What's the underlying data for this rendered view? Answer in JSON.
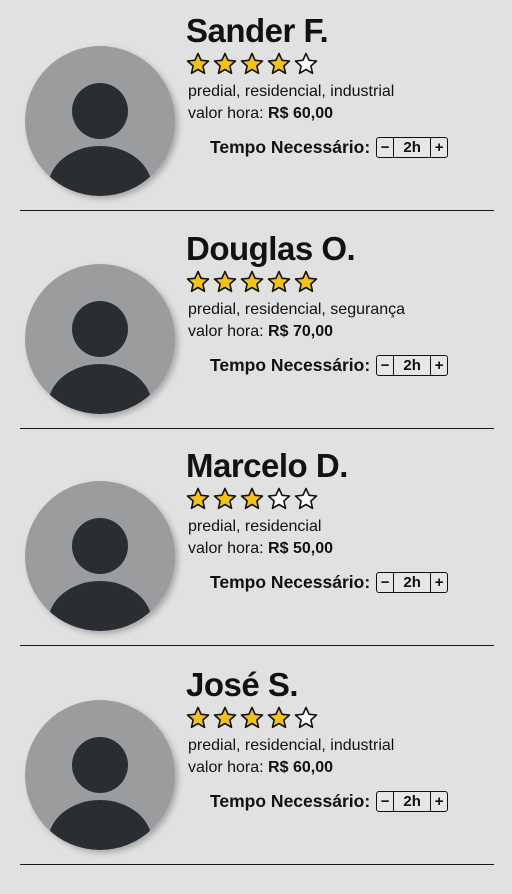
{
  "labels": {
    "rate_prefix": "valor hora:",
    "time_label": "Tempo Necessário:",
    "minus": "−",
    "plus": "+"
  },
  "colors": {
    "star_filled": "#f2c21b",
    "star_empty": "#ffffff",
    "avatar_bg": "#9b9c9e",
    "avatar_figure": "#2a2d31"
  },
  "icons": {
    "avatar": "user-silhouette-icon",
    "star": "star-icon"
  },
  "providers": [
    {
      "name": "Sander F.",
      "rating": 4,
      "max_rating": 5,
      "tags": "predial, residencial, industrial",
      "rate": "R$ 60,00",
      "time": "2h"
    },
    {
      "name": "Douglas O.",
      "rating": 5,
      "max_rating": 5,
      "tags": "predial, residencial, segurança",
      "rate": "R$ 70,00",
      "time": "2h"
    },
    {
      "name": "Marcelo D.",
      "rating": 3,
      "max_rating": 5,
      "tags": "predial, residencial",
      "rate": "R$ 50,00",
      "time": "2h"
    },
    {
      "name": "José S.",
      "rating": 4,
      "max_rating": 5,
      "tags": "predial, residencial, industrial",
      "rate": "R$ 60,00",
      "time": "2h"
    }
  ]
}
